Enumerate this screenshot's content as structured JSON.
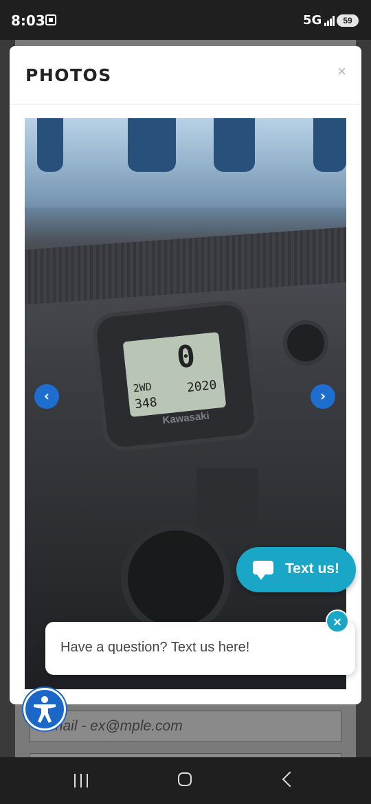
{
  "status_bar": {
    "time": "8:03",
    "network": "5G",
    "battery": "59",
    "icons": [
      "screenshot-icon",
      "signal-icon",
      "battery-icon"
    ]
  },
  "modal": {
    "title": "PHOTOS",
    "close_label": "×"
  },
  "photo": {
    "lcd_speed": "0",
    "lcd_drive": "2WD",
    "lcd_odometer": "348",
    "lcd_year": "2020",
    "brand_text": "Kawasaki"
  },
  "carousel": {
    "prev_icon": "chevron-left-icon",
    "next_icon": "chevron-right-icon",
    "prev_glyph": "‹",
    "next_glyph": "›"
  },
  "chat_widget": {
    "button_label": "Text us!",
    "prompt": "Have a question? Text us here!",
    "close_glyph": "×",
    "accent": "#1aa6c6"
  },
  "background_form": {
    "email_placeholder": "Email - ex@mple.com"
  },
  "colors": {
    "arrow": "#1e6ed0",
    "accessibility": "#1b67c7"
  }
}
